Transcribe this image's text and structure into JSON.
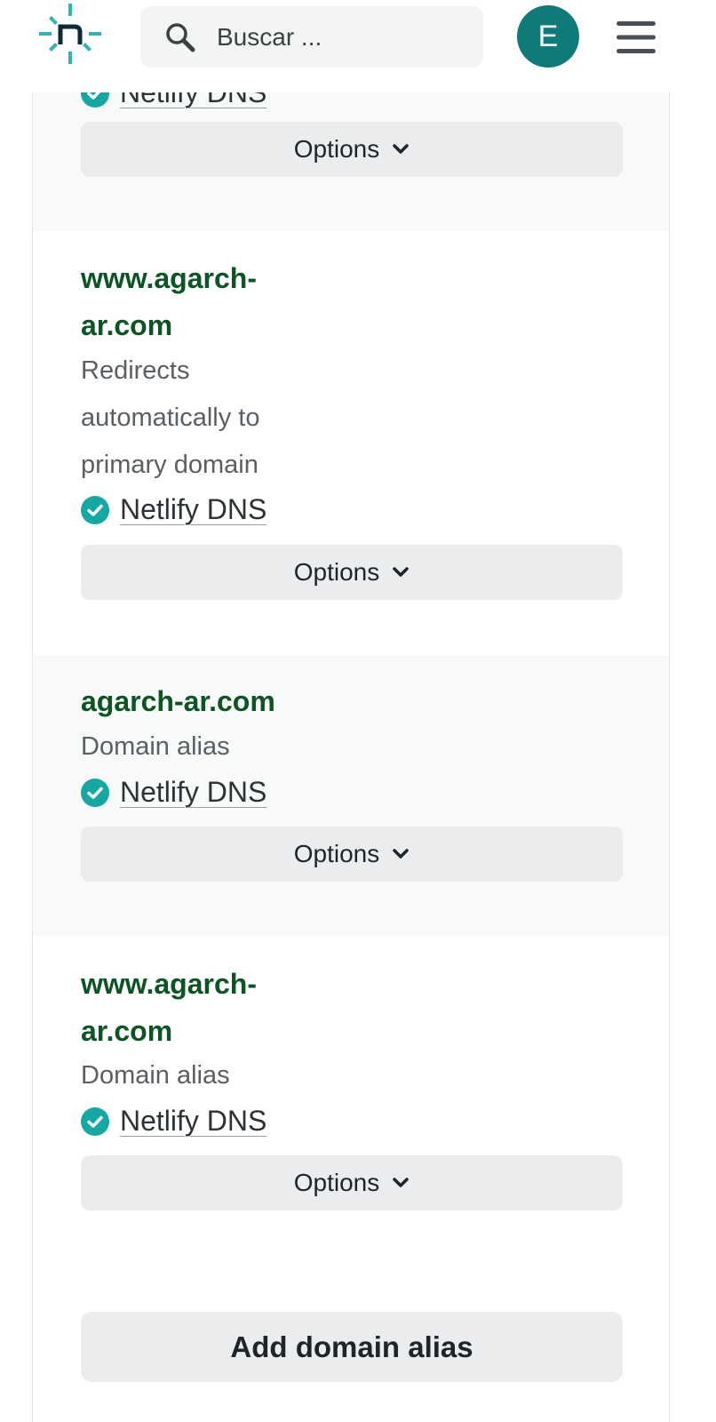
{
  "header": {
    "search_placeholder": "Buscar ...",
    "avatar_initial": "E"
  },
  "items": [
    {
      "dns_label": "Netlify DNS",
      "options_label": "Options"
    },
    {
      "domain_line1": "www.agarch-",
      "domain_line2": "ar.com",
      "desc_line1": "Redirects",
      "desc_line2": "automatically to",
      "desc_line3": "primary domain",
      "dns_label": "Netlify DNS",
      "options_label": "Options"
    },
    {
      "domain": "agarch-ar.com",
      "desc": "Domain alias",
      "dns_label": "Netlify DNS",
      "options_label": "Options"
    },
    {
      "domain_line1": "www.agarch-",
      "domain_line2": "ar.com",
      "desc": "Domain alias",
      "dns_label": "Netlify DNS",
      "options_label": "Options"
    }
  ],
  "add_alias_label": "Add domain alias",
  "colors": {
    "brand_teal": "#0e7b7a",
    "domain_green": "#0b5523",
    "check_teal": "#15a8a2"
  }
}
